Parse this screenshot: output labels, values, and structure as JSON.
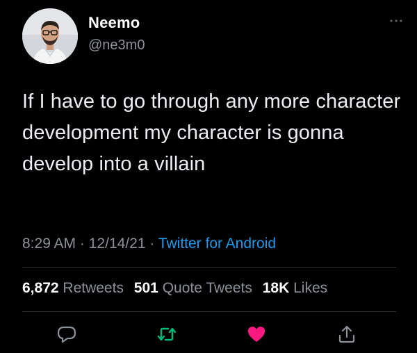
{
  "user": {
    "display_name": "Neemo",
    "handle": "@ne3m0"
  },
  "tweet": {
    "text": "If I have to go through any more character development my character is gonna develop into a villain",
    "time": "8:29 AM",
    "date": "12/14/21",
    "source": "Twitter for Android",
    "separator": "·"
  },
  "stats": {
    "retweets_count": "6,872",
    "retweets_label": "Retweets",
    "quotes_count": "501",
    "quotes_label": "Quote Tweets",
    "likes_count": "18K",
    "likes_label": "Likes"
  },
  "actions": {
    "reply_icon": "reply-icon",
    "retweet_icon": "retweet-icon",
    "like_icon": "heart-icon",
    "share_icon": "share-icon"
  },
  "colors": {
    "background": "#000000",
    "text": "#e7e9ea",
    "secondary": "#8b9298",
    "link": "#1d9bf0",
    "retweet": "#00ba7c",
    "like": "#f91880",
    "divider": "#2f3336"
  }
}
